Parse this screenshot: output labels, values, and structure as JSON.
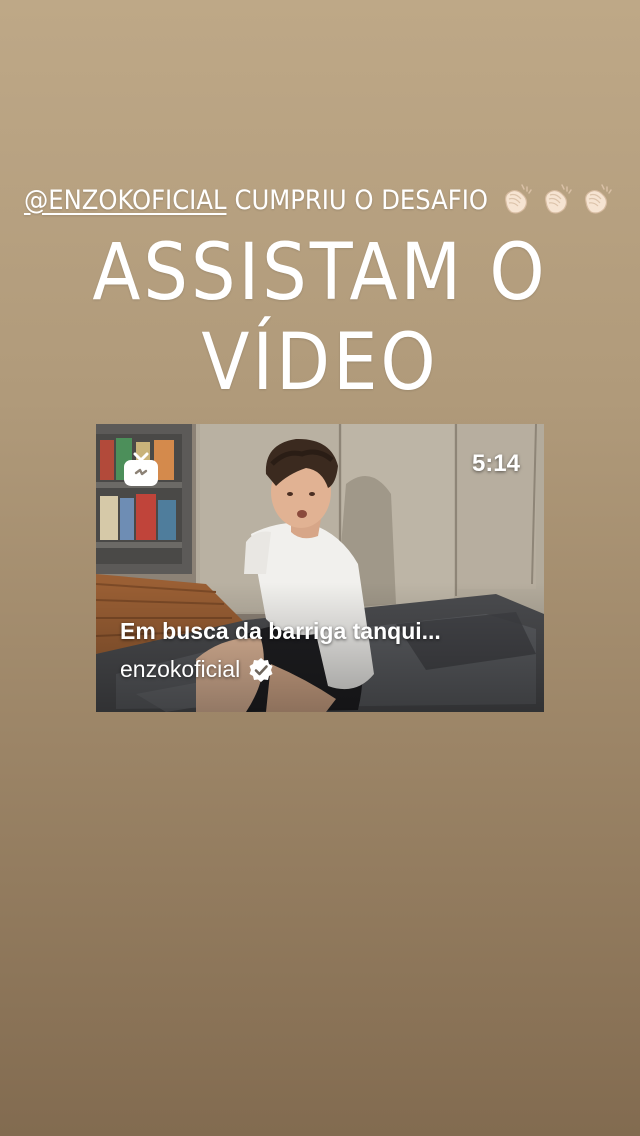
{
  "caption": {
    "mention": "@ENZOKOFICIAL",
    "text": "CUMPRIU O DESAFIO",
    "emoji": [
      "clapping-hands",
      "clapping-hands",
      "clapping-hands"
    ]
  },
  "headline": "ASSISTAM O VÍDEO",
  "video_card": {
    "icon": "igtv-icon",
    "duration": "5:14",
    "title": "Em busca da barriga tanqui...",
    "author": "enzokoficial",
    "author_verified": true
  },
  "colors": {
    "background_top": "#bea887",
    "background_bottom": "#826b50",
    "text": "#ffffff"
  }
}
